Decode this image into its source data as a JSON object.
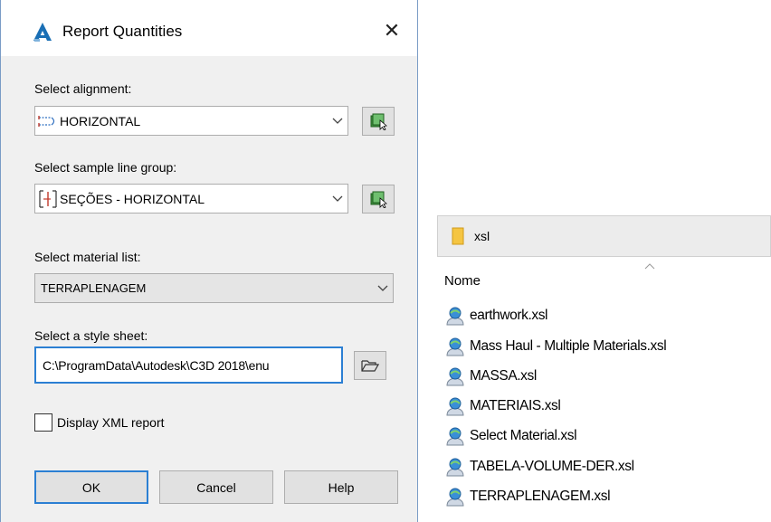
{
  "dialog": {
    "title": "Report Quantities",
    "close_symbol": "✕",
    "alignment": {
      "label": "Select alignment:",
      "value": "HORIZONTAL"
    },
    "sample_line_group": {
      "label": "Select sample line group:",
      "value": "SEÇÕES - HORIZONTAL"
    },
    "material_list": {
      "label": "Select material list:",
      "value": "TERRAPLENAGEM"
    },
    "style_sheet": {
      "label": "Select a style sheet:",
      "value": "C:\\ProgramData\\Autodesk\\C3D 2018\\enu"
    },
    "display_xml": {
      "label": "Display XML report",
      "checked": false
    },
    "buttons": {
      "ok": "OK",
      "cancel": "Cancel",
      "help": "Help"
    },
    "colors": {
      "focus_blue": "#2b7fd3",
      "icon_green": "#3f8f3f"
    }
  },
  "explorer": {
    "folder": "xsl",
    "column_header": "Nome",
    "files": [
      "earthwork.xsl",
      "Mass Haul - Multiple Materials.xsl",
      "MASSA.xsl",
      "MATERIAIS.xsl",
      "Select Material.xsl",
      "TABELA-VOLUME-DER.xsl",
      "TERRAPLENAGEM.xsl"
    ]
  }
}
